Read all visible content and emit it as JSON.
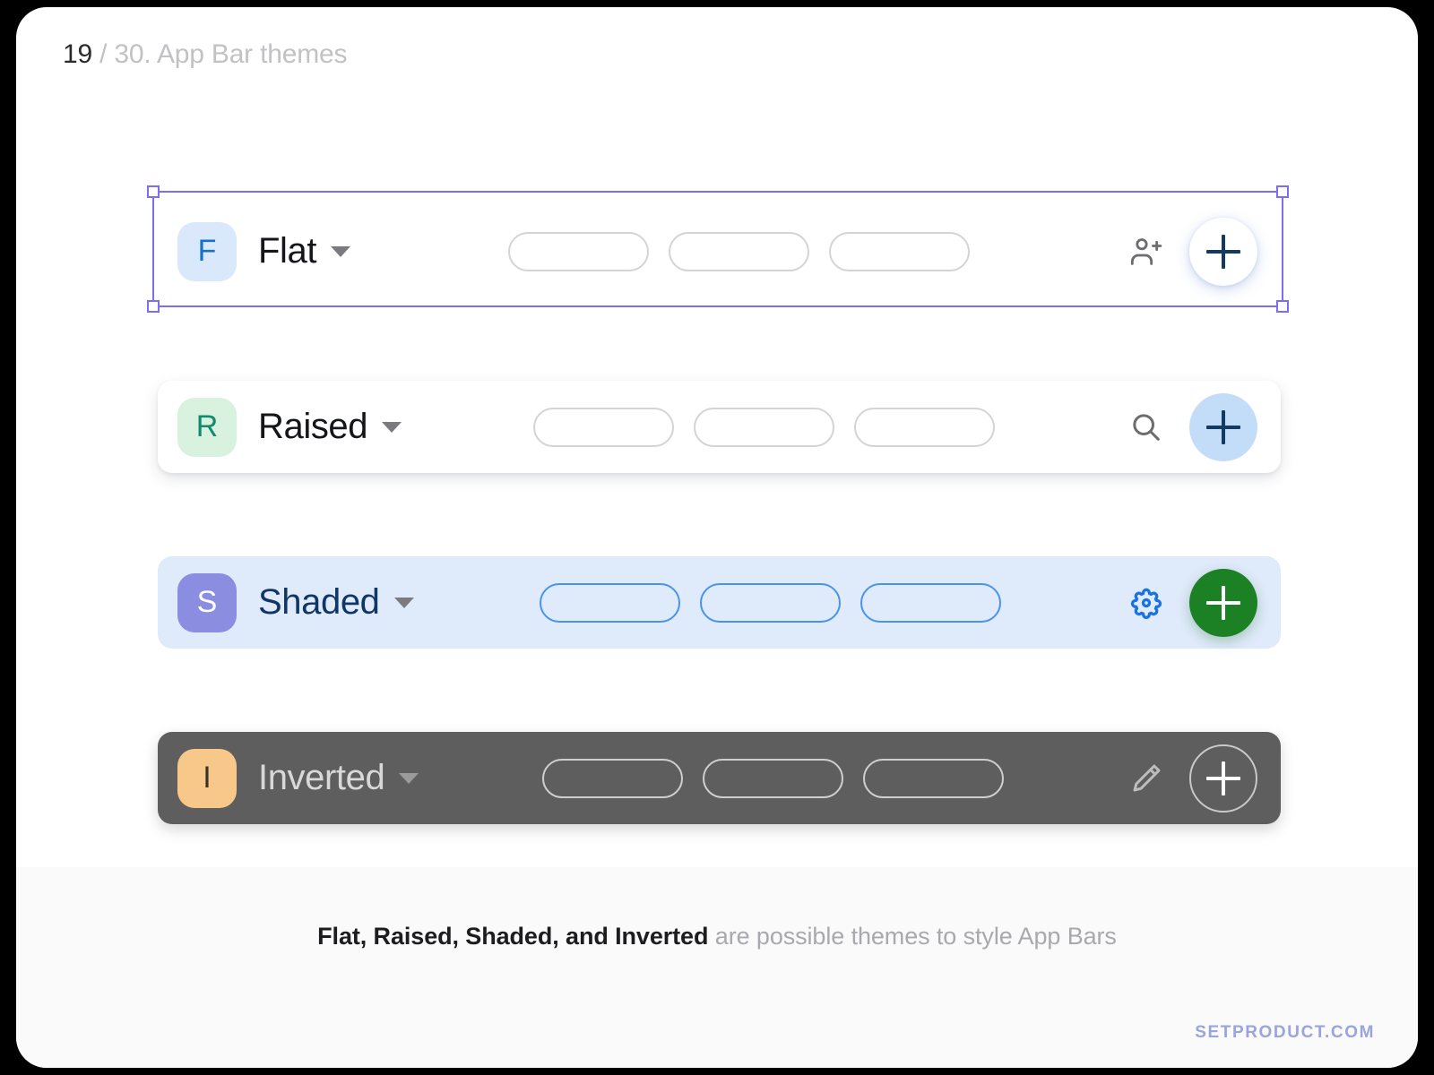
{
  "header": {
    "number": "19",
    "rest": " / 30. App Bar themes"
  },
  "bars": [
    {
      "theme": "Flat",
      "avatar_letter": "F",
      "avatar_bg": "#d9e8fa",
      "avatar_color": "#1871c9",
      "bar_bg": "#ffffff",
      "title_color": "#15161a",
      "pill_count": 3,
      "pill_border": "#d4d4d6",
      "action_icon": "person-add-icon",
      "fab_icon": "plus-icon",
      "fab_bg": "#ffffff",
      "fab_icon_color": "#123a63",
      "selected": true
    },
    {
      "theme": "Raised",
      "avatar_letter": "R",
      "avatar_bg": "#d9f2e0",
      "avatar_color": "#128a6e",
      "bar_bg": "#ffffff",
      "title_color": "#15161a",
      "pill_count": 3,
      "pill_border": "#d4d4d6",
      "action_icon": "search-icon",
      "fab_icon": "plus-icon",
      "fab_bg": "#c3ddf8",
      "fab_icon_color": "#123a63",
      "selected": false
    },
    {
      "theme": "Shaded",
      "avatar_letter": "S",
      "avatar_bg": "#8b8ee0",
      "avatar_color": "#ffffff",
      "bar_bg": "#dfeafb",
      "title_color": "#103668",
      "pill_count": 3,
      "pill_border": "#4a93ea",
      "action_icon": "gear-icon",
      "fab_icon": "plus-icon",
      "fab_bg": "#1c8124",
      "fab_icon_color": "#ffffff",
      "selected": false
    },
    {
      "theme": "Inverted",
      "avatar_letter": "I",
      "avatar_bg": "#f7c88a",
      "avatar_color": "#39322b",
      "bar_bg": "#5e5e5e",
      "title_color": "#d8d8d8",
      "pill_count": 3,
      "pill_border": "#cfcfcf",
      "action_icon": "pencil-icon",
      "fab_icon": "plus-icon",
      "fab_bg": "transparent",
      "fab_icon_color": "#ffffff",
      "selected": false
    }
  ],
  "caption": {
    "strong": "Flat, Raised, Shaded, and Inverted",
    "muted": " are possible themes to style App Bars"
  },
  "watermark": "SETPRODUCT.COM",
  "colors": {
    "selection": "#7c6ef0",
    "footer_bg": "#fafafb",
    "canvas_bg": "#ffffff"
  }
}
